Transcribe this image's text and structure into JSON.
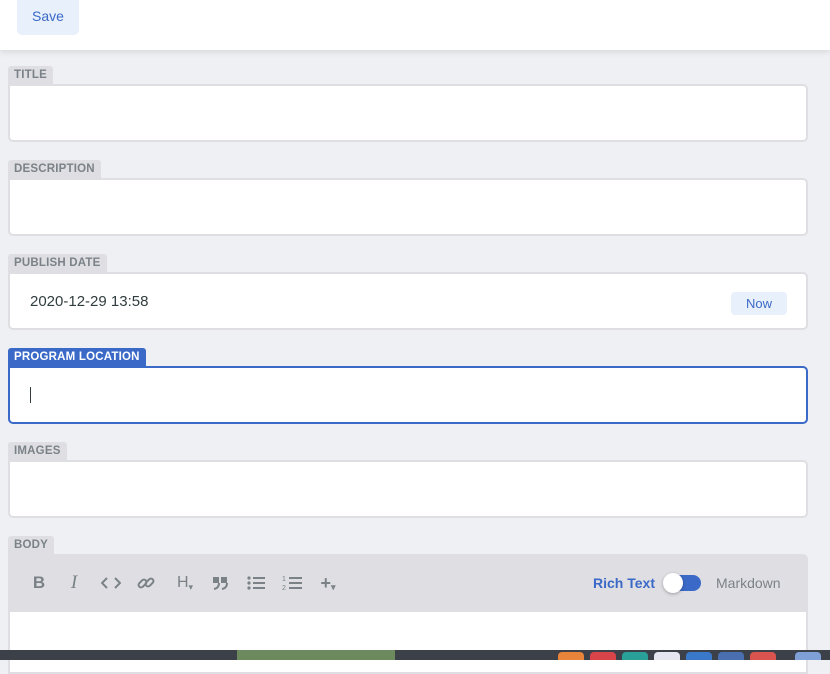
{
  "toolbar": {
    "save_label": "Save"
  },
  "fields": {
    "title": {
      "label": "TITLE",
      "value": ""
    },
    "description": {
      "label": "DESCRIPTION",
      "value": ""
    },
    "publish_date": {
      "label": "PUBLISH DATE",
      "value": "2020-12-29 13:58",
      "now_label": "Now"
    },
    "program_location": {
      "label": "PROGRAM LOCATION",
      "value": ""
    },
    "images": {
      "label": "IMAGES",
      "value": ""
    },
    "body": {
      "label": "BODY",
      "mode_rich": "Rich Text",
      "mode_markdown": "Markdown",
      "rich_text_enabled": true,
      "tools": [
        "bold-icon",
        "italic-icon",
        "code-icon",
        "link-icon",
        "heading-icon",
        "quote-icon",
        "bulleted-list-icon",
        "numbered-list-icon",
        "add-icon"
      ]
    }
  },
  "colors": {
    "accent": "#3a69c7",
    "label_bg": "#dfdfe3",
    "label_text": "#7a8288",
    "page_bg": "#eff0f4"
  }
}
